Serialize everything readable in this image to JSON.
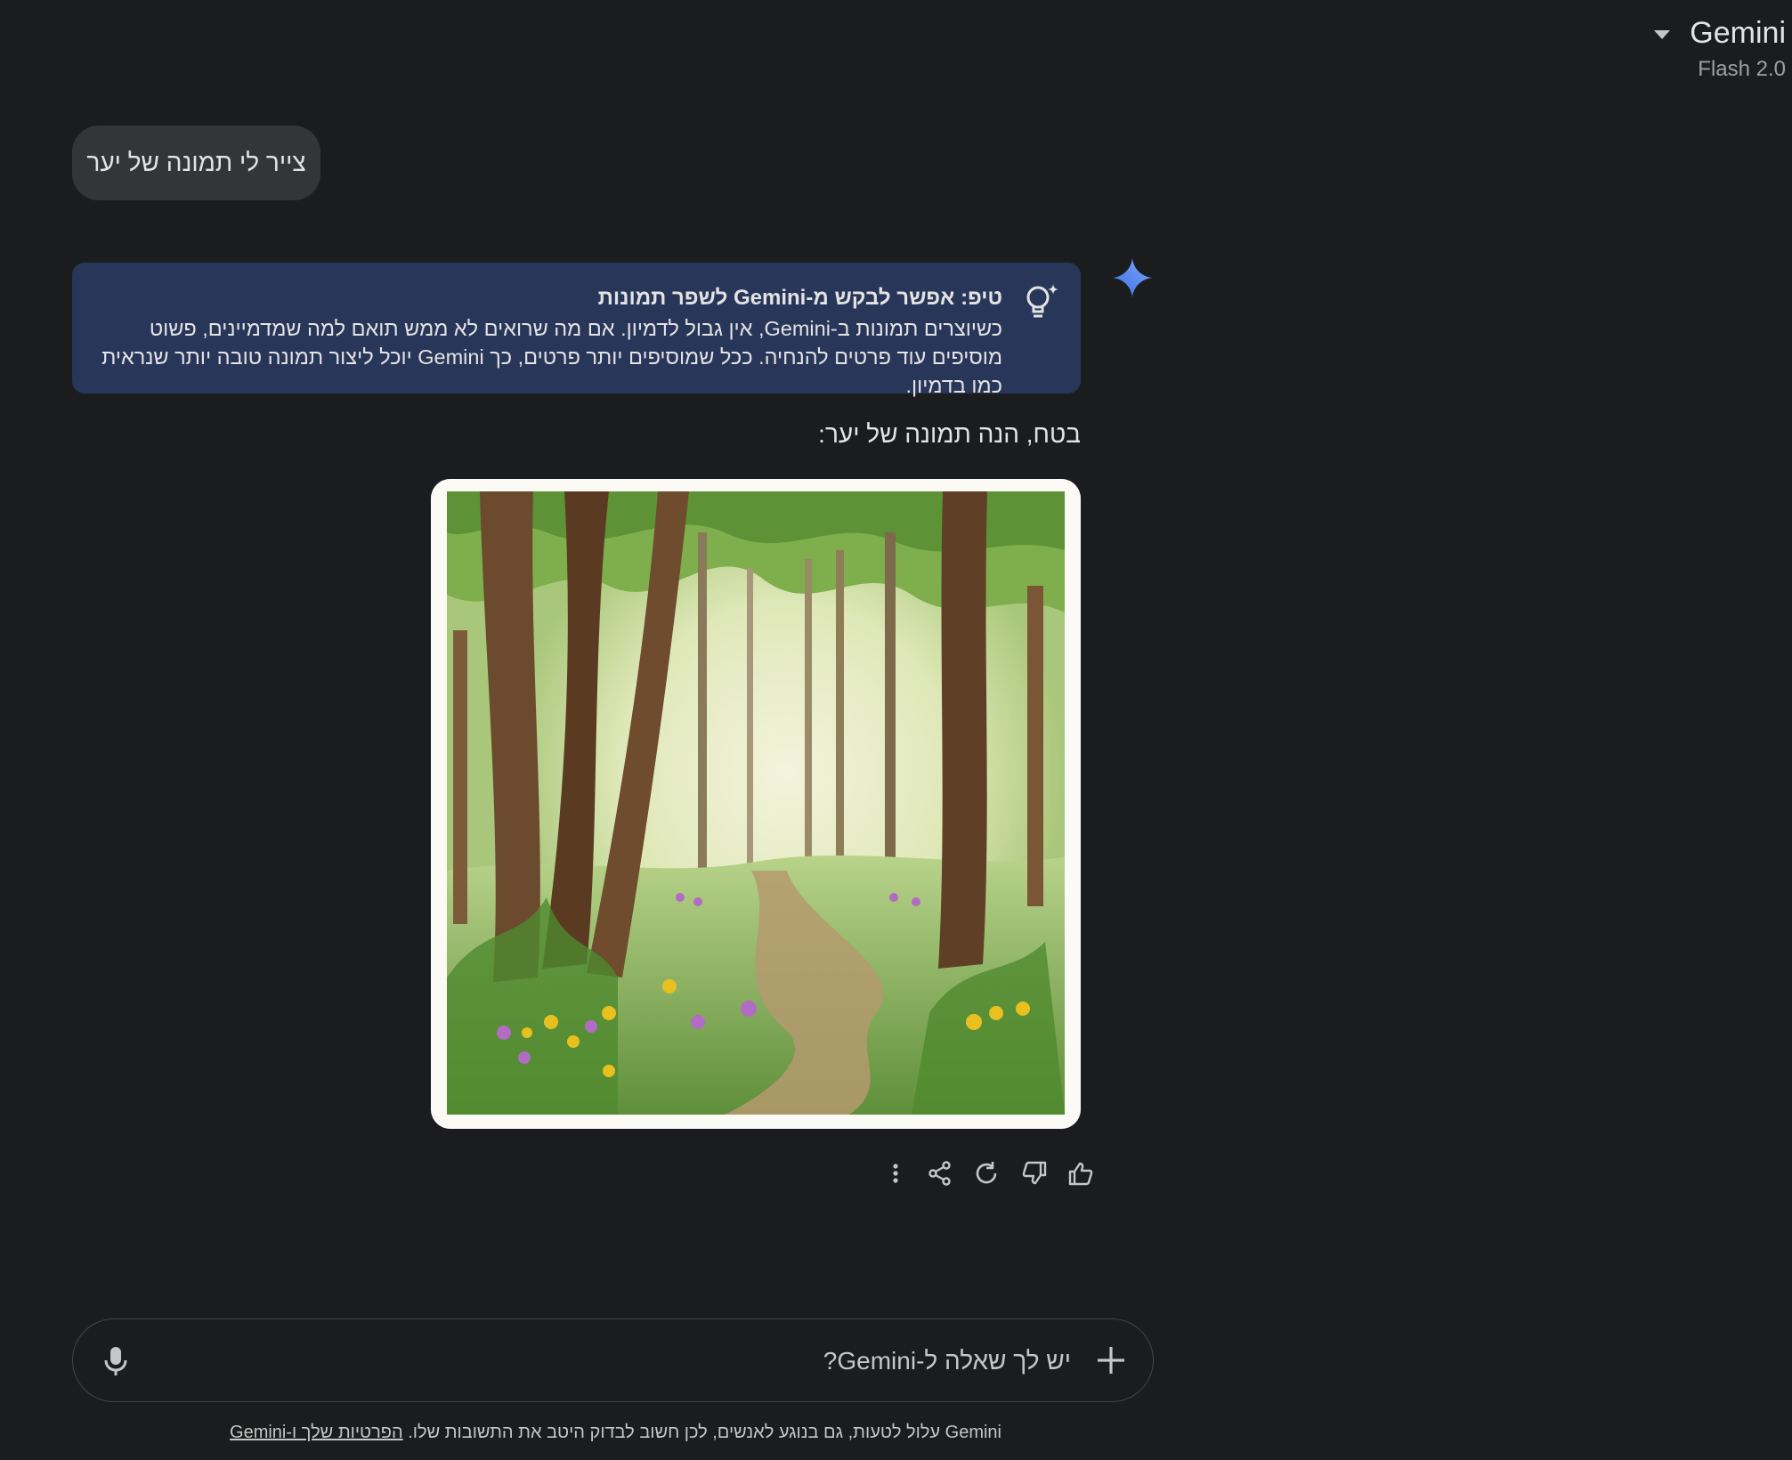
{
  "header": {
    "app_title": "Gemini",
    "model_version": "Flash 2.0",
    "caret_icon": "chevron-down-icon"
  },
  "conversation": {
    "user_message": "צייר לי תמונה של יער",
    "tip": {
      "icon": "lightbulb-sparkle-icon",
      "title": "טיפ: אפשר לבקש מ-Gemini לשפר תמונות",
      "body": "כשיוצרים תמונות ב-Gemini, אין גבול לדמיון. אם מה שרואים לא ממש תואם למה שמדמיינים, פשוט מוסיפים עוד פרטים להנחיה. ככל שמוסיפים יותר פרטים, כך Gemini יוכל ליצור תמונה טובה יותר שנראית כמו בדמיון."
    },
    "response_text": "בטח, הנה תמונה של יער:",
    "image": {
      "subject": "forest illustration",
      "icon": "gemini-spark-icon"
    },
    "actions": [
      "thumbs-up-icon",
      "thumbs-down-icon",
      "regenerate-icon",
      "share-icon",
      "more-options-icon"
    ]
  },
  "composer": {
    "placeholder": "יש לך שאלה ל-Gemini?",
    "add_icon": "plus-icon",
    "mic_icon": "microphone-icon"
  },
  "footer": {
    "disclaimer": "Gemini עלול לטעות, גם בנוגע לאנשים, לכן חשוב לבדוק היטב את התשובות שלו.",
    "privacy_link": "הפרטיות שלך ו-Gemini"
  },
  "colors": {
    "background": "#1b1c1d",
    "bubble": "#333537",
    "tip_card": "#28365a",
    "spark_blue": "#4c8df6"
  }
}
